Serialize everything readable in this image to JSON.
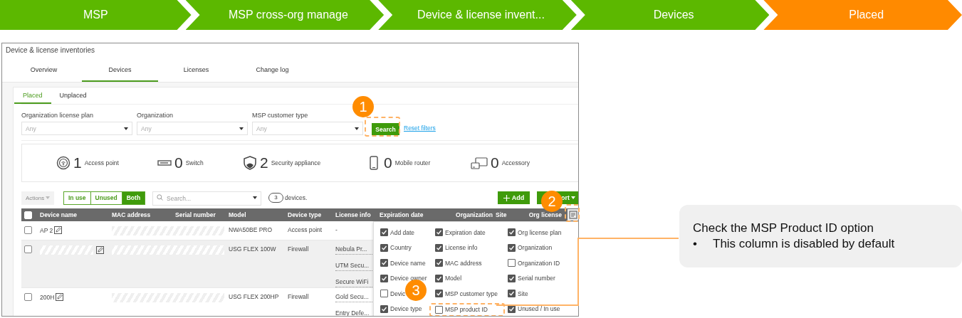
{
  "breadcrumb": [
    {
      "label": "MSP",
      "current": false
    },
    {
      "label": "MSP cross-org manage",
      "current": false
    },
    {
      "label": "Device & license invent...",
      "current": false
    },
    {
      "label": "Devices",
      "current": false
    },
    {
      "label": "Placed",
      "current": true
    }
  ],
  "window": {
    "title": "Device & license inventories"
  },
  "tabs": [
    {
      "label": "Overview",
      "selected": false
    },
    {
      "label": "Devices",
      "selected": true
    },
    {
      "label": "Licenses",
      "selected": false
    },
    {
      "label": "Change log",
      "selected": false
    }
  ],
  "subtabs": [
    {
      "label": "Placed",
      "selected": true
    },
    {
      "label": "Unplaced",
      "selected": false
    }
  ],
  "filters": [
    {
      "label": "Organization license plan",
      "placeholder": "Any"
    },
    {
      "label": "Organization",
      "placeholder": "Any"
    },
    {
      "label": "MSP customer type",
      "placeholder": "Any"
    }
  ],
  "search_button": "Search",
  "reset_link": "Reset filters",
  "summary": [
    {
      "kind": "access-point",
      "count": "1",
      "label": "Access point"
    },
    {
      "kind": "switch",
      "count": "0",
      "label": "Switch"
    },
    {
      "kind": "security",
      "count": "2",
      "label": "Security appliance"
    },
    {
      "kind": "mobile",
      "count": "0",
      "label": "Mobile router"
    },
    {
      "kind": "accessory",
      "count": "0",
      "label": "Accessory"
    }
  ],
  "toolbar": {
    "actions": {
      "label": "Actions",
      "disabled": true
    },
    "usage_filter": [
      {
        "label": "In use",
        "selected": false
      },
      {
        "label": "Unused",
        "selected": false
      },
      {
        "label": "Both",
        "selected": true
      }
    ],
    "search": {
      "placeholder": "Search..."
    },
    "count": "3",
    "count_suffix": "devices.",
    "add_button": "Add",
    "export_button": "ort"
  },
  "table": {
    "select_all_checked": false,
    "columns": [
      "Device name",
      "MAC address",
      "Serial number",
      "Model",
      "Device type",
      "License info",
      "Expiration date",
      "Organization",
      "Site",
      "Org license"
    ],
    "rows": [
      {
        "checked": false,
        "highlighted": false,
        "name": "AP 2",
        "name_masked": false,
        "model": "NWA50BE PRO",
        "device_type": "Access point",
        "license_info": [
          "-"
        ]
      },
      {
        "checked": false,
        "highlighted": true,
        "name_masked": true,
        "model": "USG FLEX 100W",
        "device_type": "Firewall",
        "license_info": [
          "Nebula Pr...",
          "UTM Secu...",
          "Secure WiFi"
        ]
      },
      {
        "checked": false,
        "highlighted": false,
        "name": "200H",
        "name_masked": false,
        "model": "USG FLEX 200HP",
        "device_type": "Firewall",
        "license_info": [
          "Gold Secu...",
          "Entry Defe..."
        ]
      }
    ]
  },
  "column_options": [
    {
      "label": "Add date",
      "checked": true
    },
    {
      "label": "Expiration date",
      "checked": true
    },
    {
      "label": "Org license plan",
      "checked": true
    },
    {
      "label": "Country",
      "checked": true
    },
    {
      "label": "License info",
      "checked": true
    },
    {
      "label": "Organization",
      "checked": true
    },
    {
      "label": "Device name",
      "checked": true
    },
    {
      "label": "MAC address",
      "checked": true
    },
    {
      "label": "Organization ID",
      "checked": false
    },
    {
      "label": "Device owner",
      "checked": true
    },
    {
      "label": "Model",
      "checked": true
    },
    {
      "label": "Serial number",
      "checked": true
    },
    {
      "label": "Devic",
      "checked": false
    },
    {
      "label": "MSP customer type",
      "checked": true
    },
    {
      "label": "Site",
      "checked": true
    },
    {
      "label": "Device type",
      "checked": true
    },
    {
      "label": "MSP product ID",
      "checked": false,
      "highlighted": true
    },
    {
      "label": "Unused / In use",
      "checked": true
    }
  ],
  "markers": [
    {
      "number": "1"
    },
    {
      "number": "2"
    },
    {
      "number": "3"
    }
  ],
  "callout": {
    "title": "Check the MSP Product ID option",
    "bullets": [
      {
        "marker": "•",
        "text": "This column is disabled by default"
      }
    ]
  }
}
